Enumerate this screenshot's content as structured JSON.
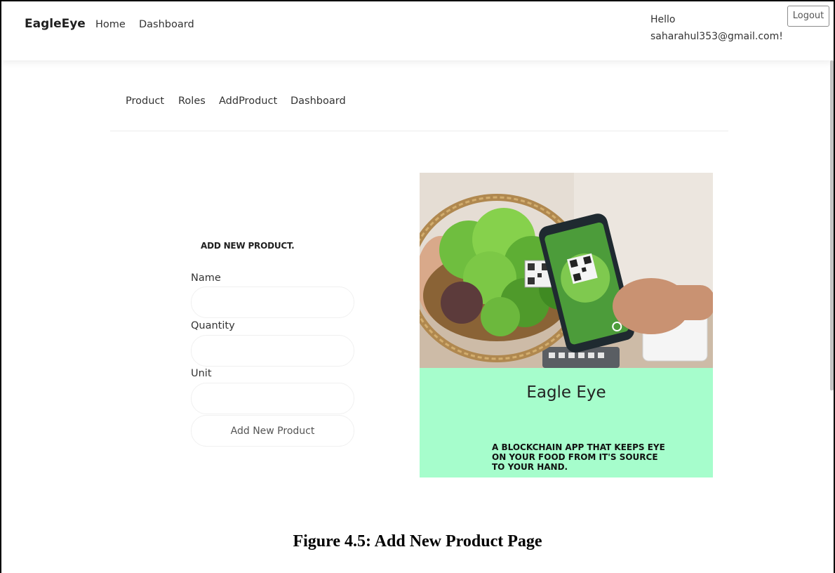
{
  "navbar": {
    "brand": "EagleEye",
    "links": [
      "Home",
      "Dashboard"
    ],
    "greeting_line1": "Hello",
    "greeting_line2": "saharahul353@gmail.com!",
    "logout_label": "Logout"
  },
  "subnav": {
    "links": [
      "Product",
      "Roles",
      "AddProduct",
      "Dashboard"
    ]
  },
  "form": {
    "title": "ADD NEW PRODUCT.",
    "fields": [
      {
        "label": "Name",
        "value": ""
      },
      {
        "label": "Quantity",
        "value": ""
      },
      {
        "label": "Unit",
        "value": ""
      }
    ],
    "submit_label": "Add New Product"
  },
  "card": {
    "title": "Eagle Eye",
    "tagline": "A BLOCKCHAIN APP THAT KEEPS EYE ON YOUR FOOD FROM IT'S SOURCE TO YOUR HAND.",
    "panel_color": "#a6fdcc"
  },
  "caption": "Figure 4.5: Add New Product Page"
}
